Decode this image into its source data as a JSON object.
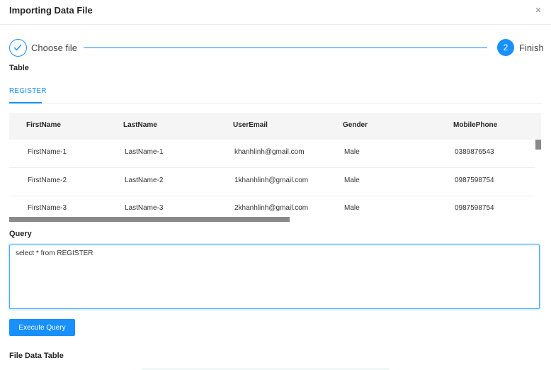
{
  "dialog": {
    "title": "Importing Data File",
    "close_glyph": "×"
  },
  "steps": [
    {
      "label": "Choose file",
      "status": "done",
      "icon": "check-icon"
    },
    {
      "number": "2",
      "label": "Finish",
      "status": "active"
    }
  ],
  "table_section": {
    "label": "Table",
    "tabs": [
      "REGISTER"
    ]
  },
  "table": {
    "columns": [
      "FirstName",
      "LastName",
      "UserEmail",
      "Gender",
      "MobilePhone"
    ],
    "rows": [
      [
        "FirstName-1",
        "LastName-1",
        "khanhlinh@gmail.com",
        "Male",
        "0389876543"
      ],
      [
        "FirstName-2",
        "LastName-2",
        "1khanhlinh@gmail.com",
        "Male",
        "0987598754"
      ],
      [
        "FirstName-3",
        "LastName-3",
        "2khanhlinh@gmail.com",
        "Male",
        "0987598754"
      ]
    ]
  },
  "query": {
    "label": "Query",
    "value": "select * from REGISTER"
  },
  "execute_button": {
    "label": "Execute Query"
  },
  "file_data_table": {
    "label": "File Data Table"
  },
  "colors": {
    "accent": "#1890ff",
    "header_bg": "#f5f5f5",
    "scrollbar": "#8a8a8a"
  }
}
